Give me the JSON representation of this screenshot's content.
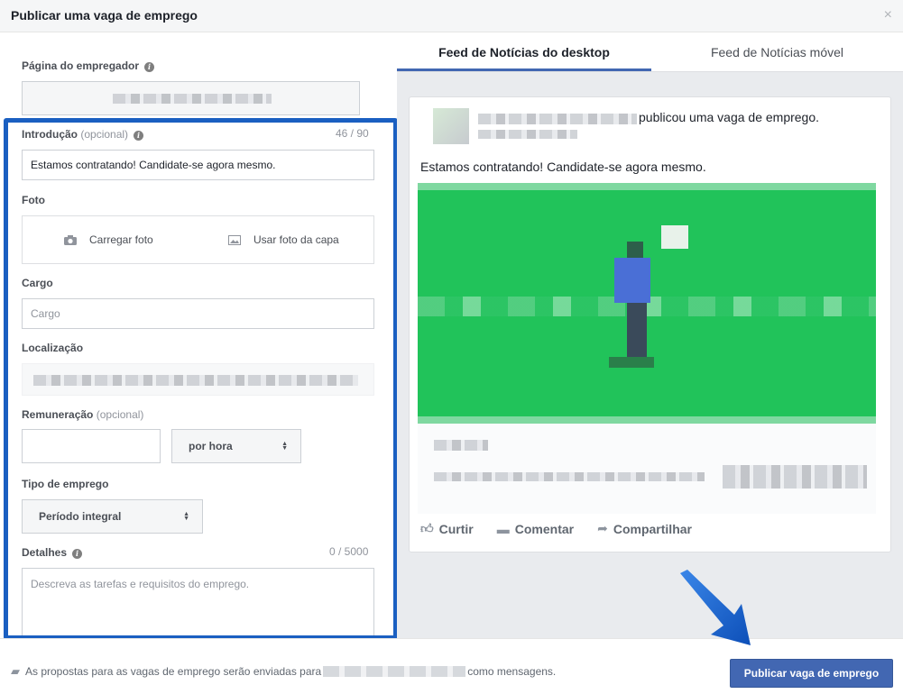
{
  "dialog": {
    "title": "Publicar uma vaga de emprego",
    "close_symbol": "×"
  },
  "form": {
    "employer_page_label": "Página do empregador",
    "intro_label": "Introdução",
    "intro_optional": "(opcional)",
    "intro_counter": "46 / 90",
    "intro_value": "Estamos contratando! Candidate-se agora mesmo.",
    "photo_label": "Foto",
    "upload_photo": "Carregar foto",
    "use_cover_photo": "Usar foto da capa",
    "job_title_label": "Cargo",
    "job_title_placeholder": "Cargo",
    "location_label": "Localização",
    "salary_label": "Remuneração",
    "salary_optional": "(opcional)",
    "salary_period": "por hora",
    "job_type_label": "Tipo de emprego",
    "job_type_value": "Período integral",
    "details_label": "Detalhes",
    "details_counter": "0 / 5000",
    "details_placeholder": "Descreva as tarefas e requisitos do emprego."
  },
  "preview": {
    "tabs": [
      "Feed de Notícias do desktop",
      "Feed de Notícias móvel"
    ],
    "header_text": "publicou uma vaga de emprego.",
    "post_text": "Estamos contratando! Candidate-se agora mesmo.",
    "actions": {
      "like": "Curtir",
      "comment": "Comentar",
      "share": "Compartilhar"
    }
  },
  "footer": {
    "message_prefix": "As propostas para as vagas de emprego serão enviadas para",
    "message_suffix": "como mensagens.",
    "publish_label": "Publicar vaga de emprego"
  },
  "icons": {
    "info": "info-icon",
    "camera": "camera-icon",
    "image": "image-icon",
    "like": "thumbs-up-icon",
    "comment": "comment-icon",
    "share": "share-arrow-icon",
    "messages": "messages-icon"
  },
  "colors": {
    "accent": "#4267b2",
    "highlight_border": "#1a5fc1",
    "preview_image": "#21c35a"
  }
}
